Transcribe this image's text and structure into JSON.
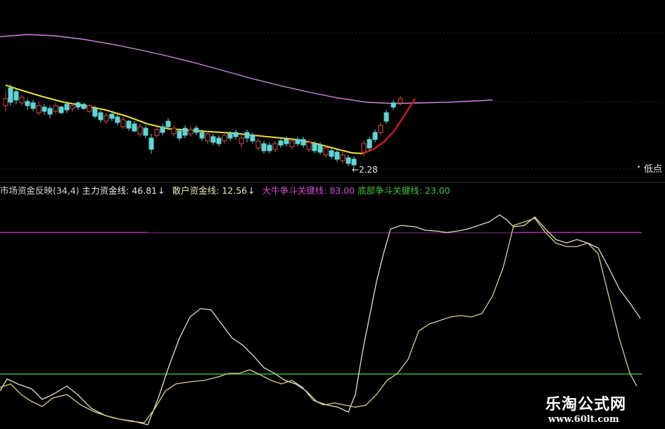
{
  "indicator": {
    "title": "市场资金反映(34,4)",
    "main_fund_label": "主力资金线:",
    "main_fund_value": "46.81",
    "retail_fund_label": "散户资金线:",
    "retail_fund_value": "12.56",
    "bull_line_label": "大牛争斗关键线:",
    "bull_line_value": "83.00",
    "bottom_line_label": "底部争斗关键线:",
    "bottom_line_value": "23.00",
    "down_arrow": "↓"
  },
  "price_chart": {
    "low_price_label": "2.28",
    "low_point_label": "低点",
    "arrow_glyph": "←"
  },
  "watermark": {
    "title": "乐淘公式网",
    "url": "www.60lt.com"
  },
  "colors": {
    "background": "#000000",
    "up_candle": "#e04a4a",
    "down_candle": "#5fd6d6",
    "ma_short": "#f2e030",
    "ma_long": "#c98ad6",
    "ma_rise": "#cc1a1a",
    "bull_line": "#b12fb1",
    "bottom_line": "#37b637",
    "main_fund_line": "#e2e2c8",
    "retail_fund_line": "#d9d08a"
  }
}
